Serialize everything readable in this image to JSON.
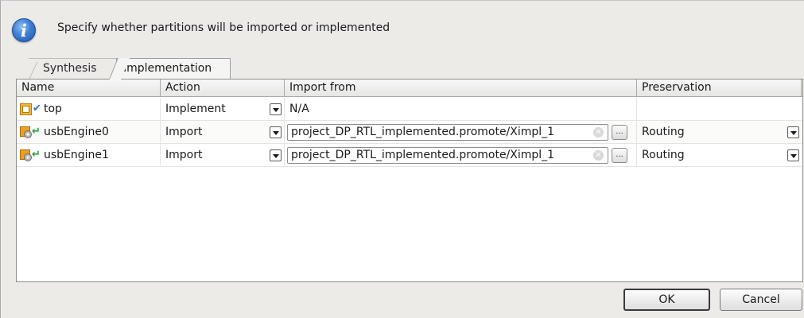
{
  "header": {
    "message": "Specify whether partitions will be imported or implemented",
    "icon": "info-icon"
  },
  "tabs": [
    {
      "label": "Synthesis",
      "selected": false
    },
    {
      "label": "Implementation",
      "selected": true
    }
  ],
  "table": {
    "columns": [
      "Name",
      "Action",
      "Import from",
      "Preservation"
    ],
    "rows": [
      {
        "name": "top",
        "icon": "partition-top-icon",
        "status_icon": "check-icon",
        "action": "Implement",
        "import_from": "N/A",
        "preservation": ""
      },
      {
        "name": "usbEngine0",
        "icon": "partition-module-icon",
        "status_icon": "import-arrow-icon",
        "action": "Import",
        "import_from": "project_DP_RTL_implemented.promote/Ximpl_1",
        "preservation": "Routing"
      },
      {
        "name": "usbEngine1",
        "icon": "partition-module-icon",
        "status_icon": "import-arrow-icon",
        "action": "Import",
        "import_from": "project_DP_RTL_implemented.promote/Ximpl_1",
        "preservation": "Routing"
      }
    ]
  },
  "buttons": {
    "ok": "OK",
    "cancel": "Cancel"
  },
  "browse_label": "...",
  "clear_glyph": "✕",
  "colors": {
    "info_icon": "#3f7fd4",
    "check": "#2d74c9",
    "arrow": "#2aa23a",
    "partition_icon": "#f0a020"
  }
}
